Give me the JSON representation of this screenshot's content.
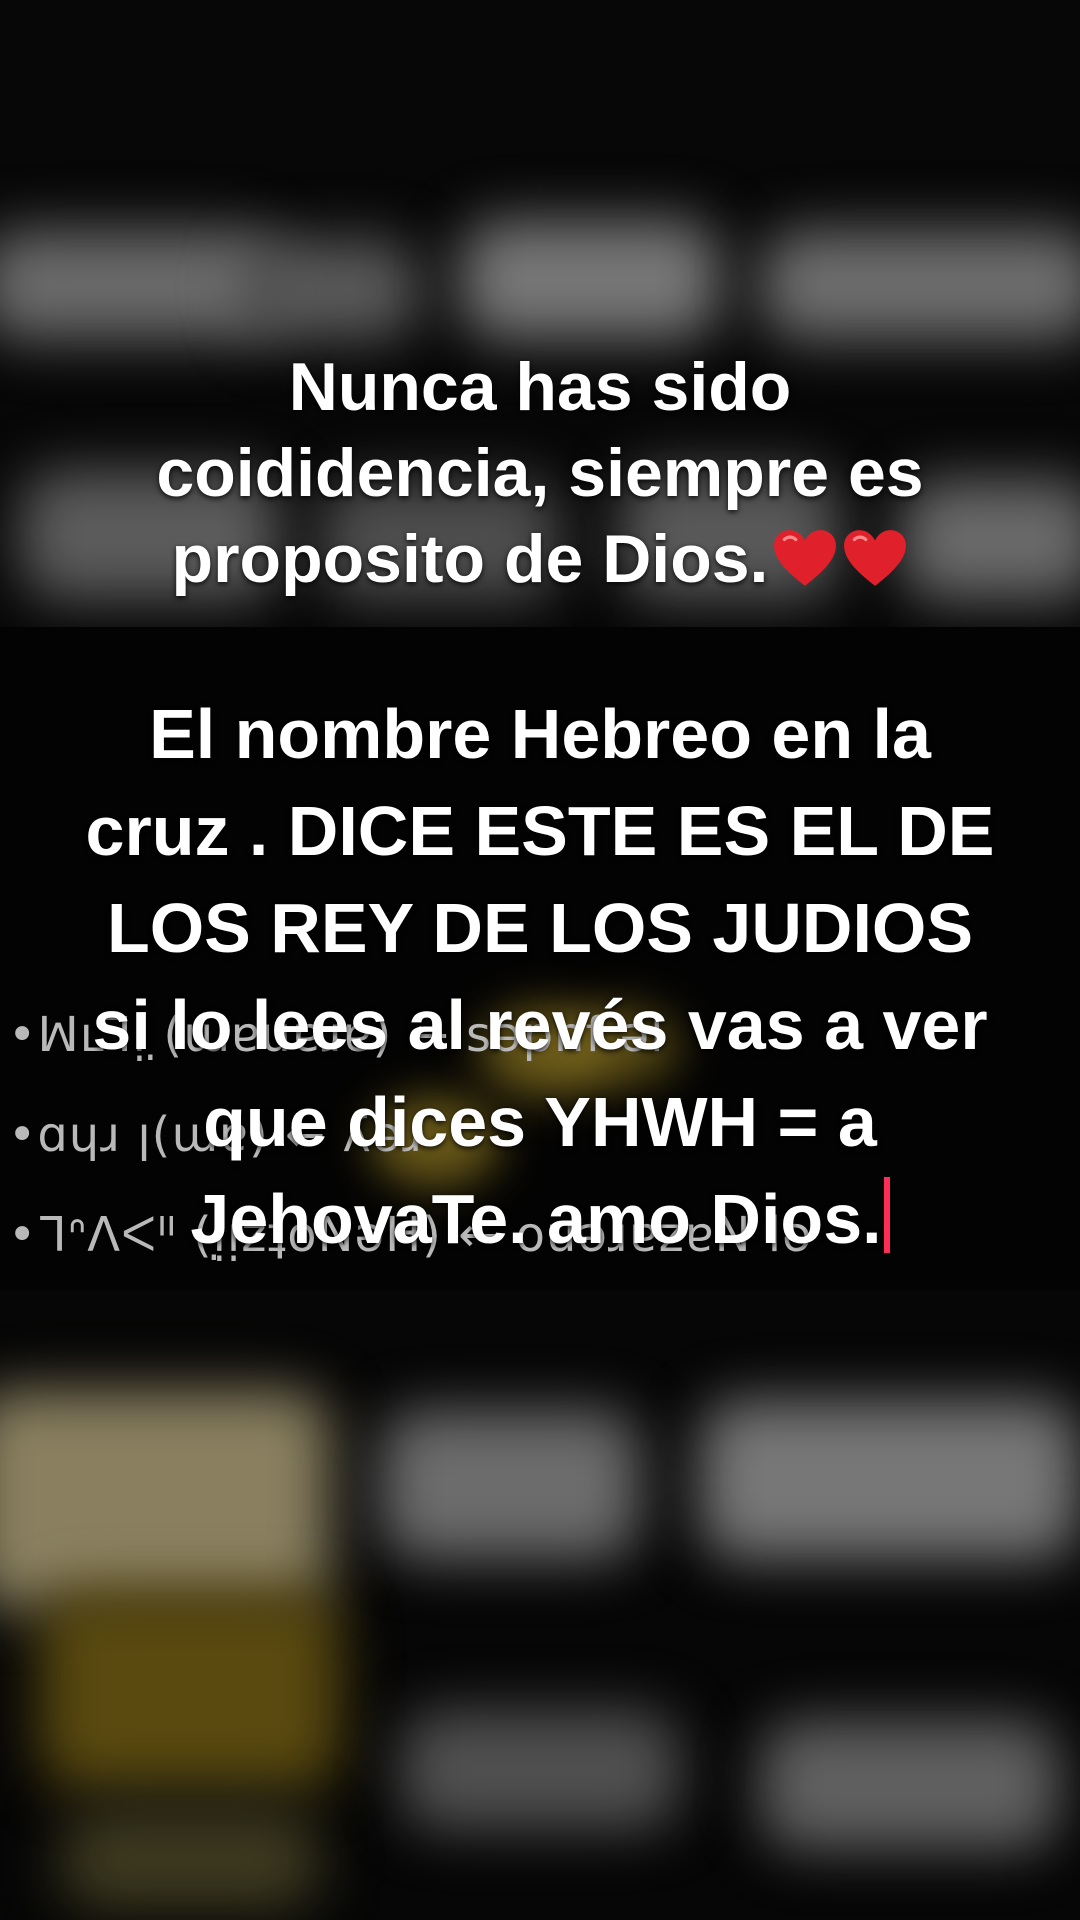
{
  "caption_top": {
    "line1": "Nunca has sido",
    "line2": "coididencia, siempre es",
    "line3": "proposito de  Dios.",
    "hearts": [
      "heart-emoji",
      "heart-emoji"
    ]
  },
  "caption_main": {
    "line1": "El nombre Hebreo en la",
    "line2": "cruz . DICE  ESTE ES EL DE",
    "line3": "LOS REY  DE LOS JUDIOS",
    "line4": "si lo lees al revés vas a ver",
    "line5": "que dices YHWH = a",
    "line6": "JehovaTe. amo Dios."
  },
  "colors": {
    "text": "#ffffff",
    "heart": "#e0202a",
    "cursor": "#ff2d55",
    "background": "#000000"
  }
}
